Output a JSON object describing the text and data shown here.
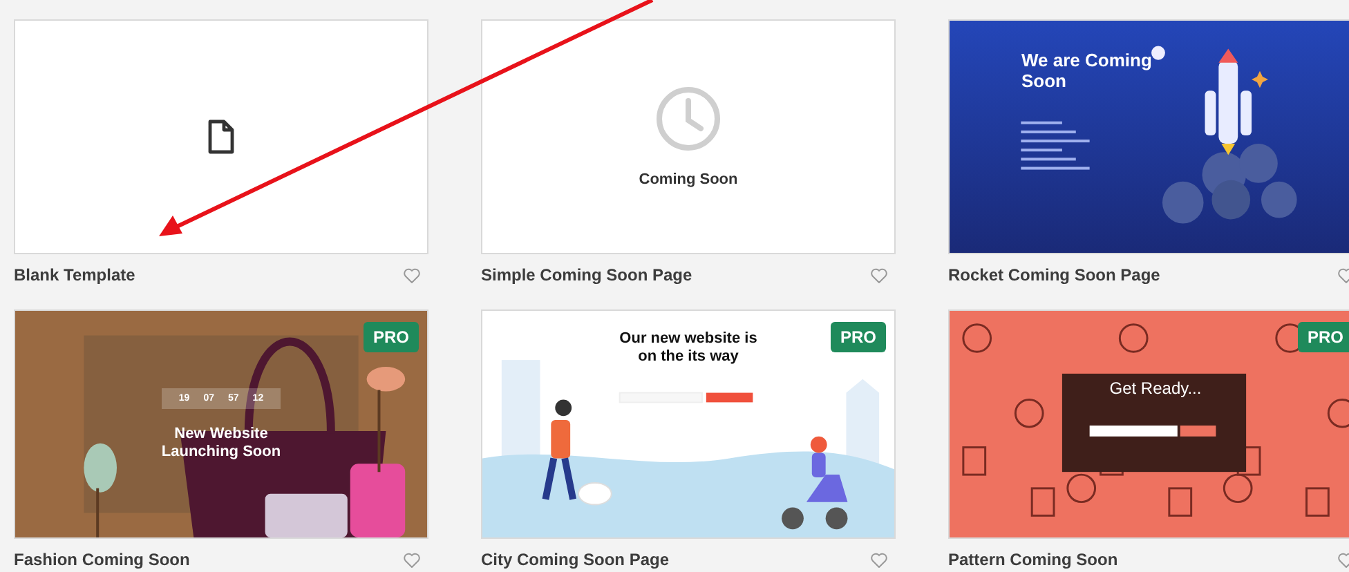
{
  "cards": [
    {
      "title": "Blank Template",
      "pro": false,
      "preview": {
        "kind": "blank"
      }
    },
    {
      "title": "Simple Coming Soon Page",
      "pro": false,
      "preview": {
        "kind": "simple",
        "heading": "Coming Soon"
      }
    },
    {
      "title": "Rocket Coming Soon Page",
      "pro": false,
      "preview": {
        "kind": "rocket",
        "heading": "We are Coming Soon"
      }
    },
    {
      "title": "Fashion Coming Soon",
      "pro": true,
      "badge": "PRO",
      "preview": {
        "kind": "fashion",
        "countdown": [
          "19",
          "07",
          "57",
          "12"
        ],
        "heading": "New Website Launching Soon"
      }
    },
    {
      "title": "City Coming Soon Page",
      "pro": true,
      "badge": "PRO",
      "preview": {
        "kind": "city",
        "heading": "Our new website is on the its way"
      }
    },
    {
      "title": "Pattern Coming Soon",
      "pro": true,
      "badge": "PRO",
      "preview": {
        "kind": "pattern",
        "heading": "Get Ready..."
      }
    }
  ],
  "annotation": {
    "kind": "arrow"
  }
}
